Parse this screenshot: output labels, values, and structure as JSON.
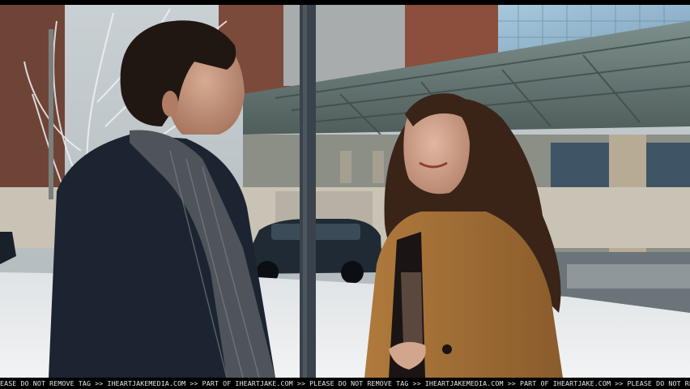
{
  "image": {
    "kind": "film still",
    "watermark_text": "EASE DO NOT REMOVE TAG >> IHEARTJAKEMEDIA.COM >> PART OF IHEARTJAKE.COM >> PLEASE DO NOT REMOVE TAG >> IHEARTJAKEMEDIA.COM >> PART OF IHEARTJAKE.COM >> PLEASE DO NOT REMOVE TAG >> IHEARTJ"
  },
  "colors": {
    "sky": "#b9c3c8",
    "building_glass": "#8fb6cf",
    "brick": "#7a4a3a",
    "canopy": "#5e6f6c",
    "snow": "#e9ecee",
    "coat_dark": "#1b2430",
    "coat_tan": "#9a6a34",
    "hair_brown": "#3a2418",
    "skin": "#c99a82"
  }
}
